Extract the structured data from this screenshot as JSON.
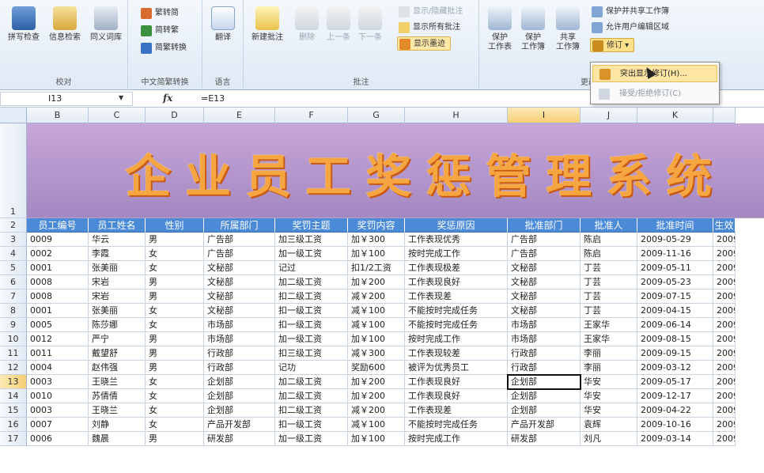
{
  "ribbon": {
    "groups": [
      {
        "id": "proofing",
        "label": "校对",
        "buttons": [
          {
            "label": "拼写检查",
            "icon": "spellcheck-icon"
          },
          {
            "label": "信息检索",
            "icon": "research-icon"
          },
          {
            "label": "同义词库",
            "icon": "thesaurus-icon"
          }
        ]
      },
      {
        "id": "chinese",
        "label": "中文简繁转换",
        "small_buttons": [
          {
            "label": "繁转简",
            "icon": "trad-to-simp-icon"
          },
          {
            "label": "简转繁",
            "icon": "simp-to-trad-icon"
          },
          {
            "label": "简繁转换",
            "icon": "convert-icon"
          }
        ]
      },
      {
        "id": "language",
        "label": "语言",
        "buttons": [
          {
            "label": "翻译",
            "icon": "translate-icon"
          }
        ]
      },
      {
        "id": "comments",
        "label": "批注",
        "buttons": [
          {
            "label": "新建批注",
            "icon": "new-comment-icon",
            "disabled": false
          },
          {
            "label": "删除",
            "icon": "delete-comment-icon",
            "disabled": true
          },
          {
            "label": "上一条",
            "icon": "prev-comment-icon",
            "disabled": true
          },
          {
            "label": "下一条",
            "icon": "next-comment-icon",
            "disabled": true
          }
        ],
        "small_buttons": [
          {
            "label": "显示/隐藏批注",
            "icon": "show-hide-comment-icon",
            "disabled": true
          },
          {
            "label": "显示所有批注",
            "icon": "show-all-comments-icon",
            "disabled": false
          },
          {
            "label": "显示墨迹",
            "icon": "show-ink-icon",
            "disabled": false
          }
        ]
      },
      {
        "id": "changes",
        "label": "更改",
        "buttons": [
          {
            "label1": "保护",
            "label2": "工作表",
            "icon": "protect-sheet-icon"
          },
          {
            "label1": "保护",
            "label2": "工作簿",
            "icon": "protect-workbook-icon"
          },
          {
            "label1": "共享",
            "label2": "工作簿",
            "icon": "share-workbook-icon"
          }
        ],
        "small_buttons": [
          {
            "label": "保护并共享工作簿",
            "icon": "protect-share-icon"
          },
          {
            "label": "允许用户编辑区域",
            "icon": "allow-edit-ranges-icon"
          },
          {
            "label": "修订 ▾",
            "icon": "track-changes-icon"
          }
        ]
      }
    ],
    "dropdown": {
      "items": [
        {
          "label": "突出显示修订(H)...",
          "icon": "highlight-changes-icon",
          "disabled": false
        },
        {
          "label": "接受/拒绝修订(C)",
          "icon": "accept-reject-icon",
          "disabled": true
        }
      ]
    }
  },
  "formula_bar": {
    "name_box": "I13",
    "fx": "fx",
    "formula": "=E13"
  },
  "sheet": {
    "columns": [
      "B",
      "C",
      "D",
      "E",
      "F",
      "G",
      "H",
      "I",
      "J",
      "K",
      ""
    ],
    "active_column": "I",
    "active_row": "13",
    "title": "企业员工奖惩管理系统",
    "headers": [
      "员工编号",
      "员工姓名",
      "性别",
      "所属部门",
      "奖罚主题",
      "奖罚内容",
      "奖惩原因",
      "批准部门",
      "批准人",
      "批准时间",
      "生效"
    ],
    "rows": [
      {
        "num": "3",
        "cells": [
          "0009",
          "华云",
          "男",
          "广告部",
          "加三级工资",
          "加￥300",
          "工作表现优秀",
          "广告部",
          "陈启",
          "2009-05-29",
          "2009"
        ]
      },
      {
        "num": "4",
        "cells": [
          "0002",
          "李霞",
          "女",
          "广告部",
          "加一级工资",
          "加￥100",
          "按时完成工作",
          "广告部",
          "陈启",
          "2009-11-16",
          "2009"
        ]
      },
      {
        "num": "5",
        "cells": [
          "0001",
          "张美丽",
          "女",
          "文秘部",
          "记过",
          "扣1/2工资",
          "工作表现极差",
          "文秘部",
          "丁芸",
          "2009-05-11",
          "2009"
        ]
      },
      {
        "num": "6",
        "cells": [
          "0008",
          "宋岩",
          "男",
          "文秘部",
          "加二级工资",
          "加￥200",
          "工作表现良好",
          "文秘部",
          "丁芸",
          "2009-05-23",
          "2009"
        ]
      },
      {
        "num": "7",
        "cells": [
          "0008",
          "宋岩",
          "男",
          "文秘部",
          "扣二级工资",
          "减￥200",
          "工作表现差",
          "文秘部",
          "丁芸",
          "2009-07-15",
          "2009"
        ]
      },
      {
        "num": "8",
        "cells": [
          "0001",
          "张美丽",
          "女",
          "文秘部",
          "扣一级工资",
          "减￥100",
          "不能按时完成任务",
          "文秘部",
          "丁芸",
          "2009-04-15",
          "2009"
        ]
      },
      {
        "num": "9",
        "cells": [
          "0005",
          "陈莎娜",
          "女",
          "市场部",
          "扣一级工资",
          "减￥100",
          "不能按时完成任务",
          "市场部",
          "王家华",
          "2009-06-14",
          "2009"
        ]
      },
      {
        "num": "10",
        "cells": [
          "0012",
          "严宁",
          "男",
          "市场部",
          "加一级工资",
          "加￥100",
          "按时完成工作",
          "市场部",
          "王家华",
          "2009-08-15",
          "2009"
        ]
      },
      {
        "num": "11",
        "cells": [
          "0011",
          "戴望舒",
          "男",
          "行政部",
          "扣三级工资",
          "减￥300",
          "工作表现较差",
          "行政部",
          "李丽",
          "2009-09-15",
          "2009"
        ]
      },
      {
        "num": "12",
        "cells": [
          "0004",
          "赵伟强",
          "男",
          "行政部",
          "记功",
          "奖励600",
          "被评为优秀员工",
          "行政部",
          "李丽",
          "2009-03-12",
          "2009"
        ]
      },
      {
        "num": "13",
        "cells": [
          "0003",
          "王晓兰",
          "女",
          "企划部",
          "加二级工资",
          "加￥200",
          "工作表现良好",
          "企划部",
          "华安",
          "2009-05-17",
          "2009"
        ]
      },
      {
        "num": "14",
        "cells": [
          "0010",
          "苏倩倩",
          "女",
          "企划部",
          "加二级工资",
          "加￥200",
          "工作表现良好",
          "企划部",
          "华安",
          "2009-12-17",
          "2009"
        ]
      },
      {
        "num": "15",
        "cells": [
          "0003",
          "王晓兰",
          "女",
          "企划部",
          "扣二级工资",
          "减￥200",
          "工作表现差",
          "企划部",
          "华安",
          "2009-04-22",
          "2009"
        ]
      },
      {
        "num": "16",
        "cells": [
          "0007",
          "刘静",
          "女",
          "产品开发部",
          "扣一级工资",
          "减￥100",
          "不能按时完成任务",
          "产品开发部",
          "袁辉",
          "2009-10-16",
          "2009"
        ]
      },
      {
        "num": "17",
        "cells": [
          "0006",
          "魏晨",
          "男",
          "研发部",
          "加一级工资",
          "加￥100",
          "按时完成工作",
          "研发部",
          "刘凡",
          "2009-03-14",
          "2009"
        ]
      }
    ]
  },
  "colors": {
    "header_fill": "#4a8ad6",
    "title_band": "#b596cc",
    "title_text": "#f6a640"
  }
}
